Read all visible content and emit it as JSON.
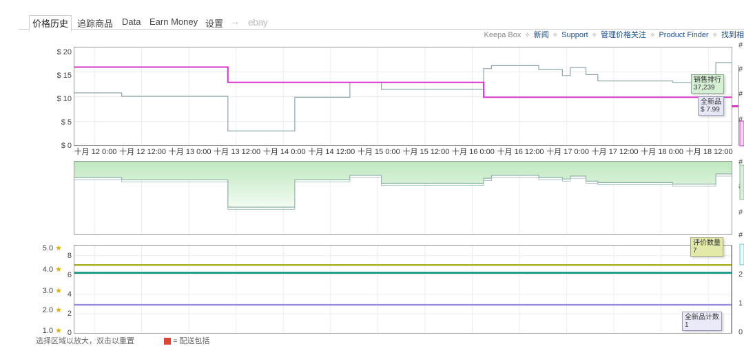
{
  "tabs": [
    {
      "label": "价格历史",
      "active": true
    },
    {
      "label": "追踪商品"
    },
    {
      "label": "Data"
    },
    {
      "label": "Earn Money"
    },
    {
      "label": "设置"
    },
    {
      "label": "→"
    },
    {
      "label": "ebay"
    }
  ],
  "links": [
    "Keepa Box",
    "新闻",
    "Support",
    "管理价格关注",
    "Product Finder",
    "找到相"
  ],
  "colors": {
    "new_price": "#d633c8",
    "amazon_price": "#8fa5a8",
    "rank_fill": "#c9ecc9",
    "rank_line": "#8fb2a8",
    "rating": "#aab22a",
    "review_count": "#1f9e8e",
    "new_count": "#9b8ae6"
  },
  "chart_data": [
    {
      "type": "line",
      "name": "price",
      "y_ticks": [
        "$ 20",
        "$ 15",
        "$ 10",
        "$ 5",
        "$ 0"
      ],
      "ylim": [
        0,
        20
      ],
      "x_ticks": [
        "十月 12 0:00",
        "十月 12 12:00",
        "十月 13 0:00",
        "十月 13 12:00",
        "十月 14 0:00",
        "十月 14 12:00",
        "十月 15 0:00",
        "十月 15 12:00",
        "十月 16 0:00",
        "十月 16 12:00",
        "十月 17 0:00",
        "十月 17 12:00",
        "十月 18 0:00",
        "十月 18 12:00"
      ],
      "x_tick_hours": [
        0,
        12,
        24,
        36,
        48,
        60,
        72,
        84,
        96,
        108,
        120,
        132,
        144,
        156
      ],
      "xlim_hours": [
        -5,
        162
      ],
      "series": [
        {
          "name": "全新品",
          "color": "#d633c8",
          "points": [
            [
              -5,
              15.9
            ],
            [
              34,
              15.9
            ],
            [
              34,
              12.8
            ],
            [
              99,
              12.8
            ],
            [
              99,
              9.8
            ],
            [
              162,
              9.8
            ]
          ]
        },
        {
          "name": "",
          "color": "#8fa5a8",
          "points": [
            [
              -5,
              10.7
            ],
            [
              7,
              10.7
            ],
            [
              7,
              10.0
            ],
            [
              34,
              10.0
            ],
            [
              34,
              3.0
            ],
            [
              51,
              3.0
            ],
            [
              51,
              9.8
            ],
            [
              65,
              9.8
            ],
            [
              65,
              12.8
            ],
            [
              73,
              12.8
            ],
            [
              73,
              11.4
            ],
            [
              99,
              11.4
            ],
            [
              99,
              15.6
            ],
            [
              101,
              15.6
            ],
            [
              101,
              16.2
            ],
            [
              113,
              16.2
            ],
            [
              113,
              15.4
            ],
            [
              119,
              15.4
            ],
            [
              119,
              14.2
            ],
            [
              121,
              14.2
            ],
            [
              121,
              15.8
            ],
            [
              125,
              15.8
            ],
            [
              125,
              14.4
            ],
            [
              128,
              14.4
            ],
            [
              128,
              13.1
            ],
            [
              147,
              13.1
            ],
            [
              147,
              12.8
            ],
            [
              158,
              12.8
            ],
            [
              158,
              16.8
            ],
            [
              162,
              16.8
            ]
          ]
        }
      ],
      "tooltips": [
        {
          "label": "销售排行",
          "value": "37,239"
        },
        {
          "label": "全新品",
          "value": "$ 7.99"
        }
      ]
    },
    {
      "type": "area",
      "name": "sales_rank",
      "ylim": [
        0,
        100
      ],
      "points": [
        [
          -5,
          78
        ],
        [
          7,
          78
        ],
        [
          7,
          75
        ],
        [
          34,
          75
        ],
        [
          34,
          37
        ],
        [
          51,
          37
        ],
        [
          51,
          75
        ],
        [
          65,
          75
        ],
        [
          65,
          81
        ],
        [
          73,
          81
        ],
        [
          73,
          70
        ],
        [
          99,
          70
        ],
        [
          99,
          77
        ],
        [
          101,
          77
        ],
        [
          101,
          81
        ],
        [
          113,
          81
        ],
        [
          113,
          78
        ],
        [
          119,
          78
        ],
        [
          119,
          76
        ],
        [
          121,
          76
        ],
        [
          121,
          80
        ],
        [
          125,
          80
        ],
        [
          125,
          73
        ],
        [
          128,
          73
        ],
        [
          128,
          71
        ],
        [
          147,
          71
        ],
        [
          147,
          69
        ],
        [
          158,
          69
        ],
        [
          158,
          83
        ],
        [
          162,
          83
        ]
      ]
    },
    {
      "type": "line",
      "name": "reviews",
      "left_ticks": [
        "5.0",
        "4.0",
        "3.0",
        "2.0",
        "1.0"
      ],
      "right_ticks": [
        "8",
        "6",
        "4",
        "2",
        "0"
      ],
      "right_ylim": [
        0,
        9
      ],
      "series": [
        {
          "name": "",
          "color": "#aab22a",
          "value": 7.0
        },
        {
          "name": "评价数量",
          "color": "#1f9e8e",
          "value": 6.2
        },
        {
          "name": "全新品计数",
          "color": "#9b8ae6",
          "value": 2.9
        }
      ],
      "tooltips": [
        {
          "label": "评价数量",
          "value": "7"
        },
        {
          "label": "全新品计数",
          "value": "1"
        }
      ]
    }
  ],
  "footer": {
    "hint": "选择区域以放大，双击以重置",
    "shipping": "= 配送包括"
  }
}
